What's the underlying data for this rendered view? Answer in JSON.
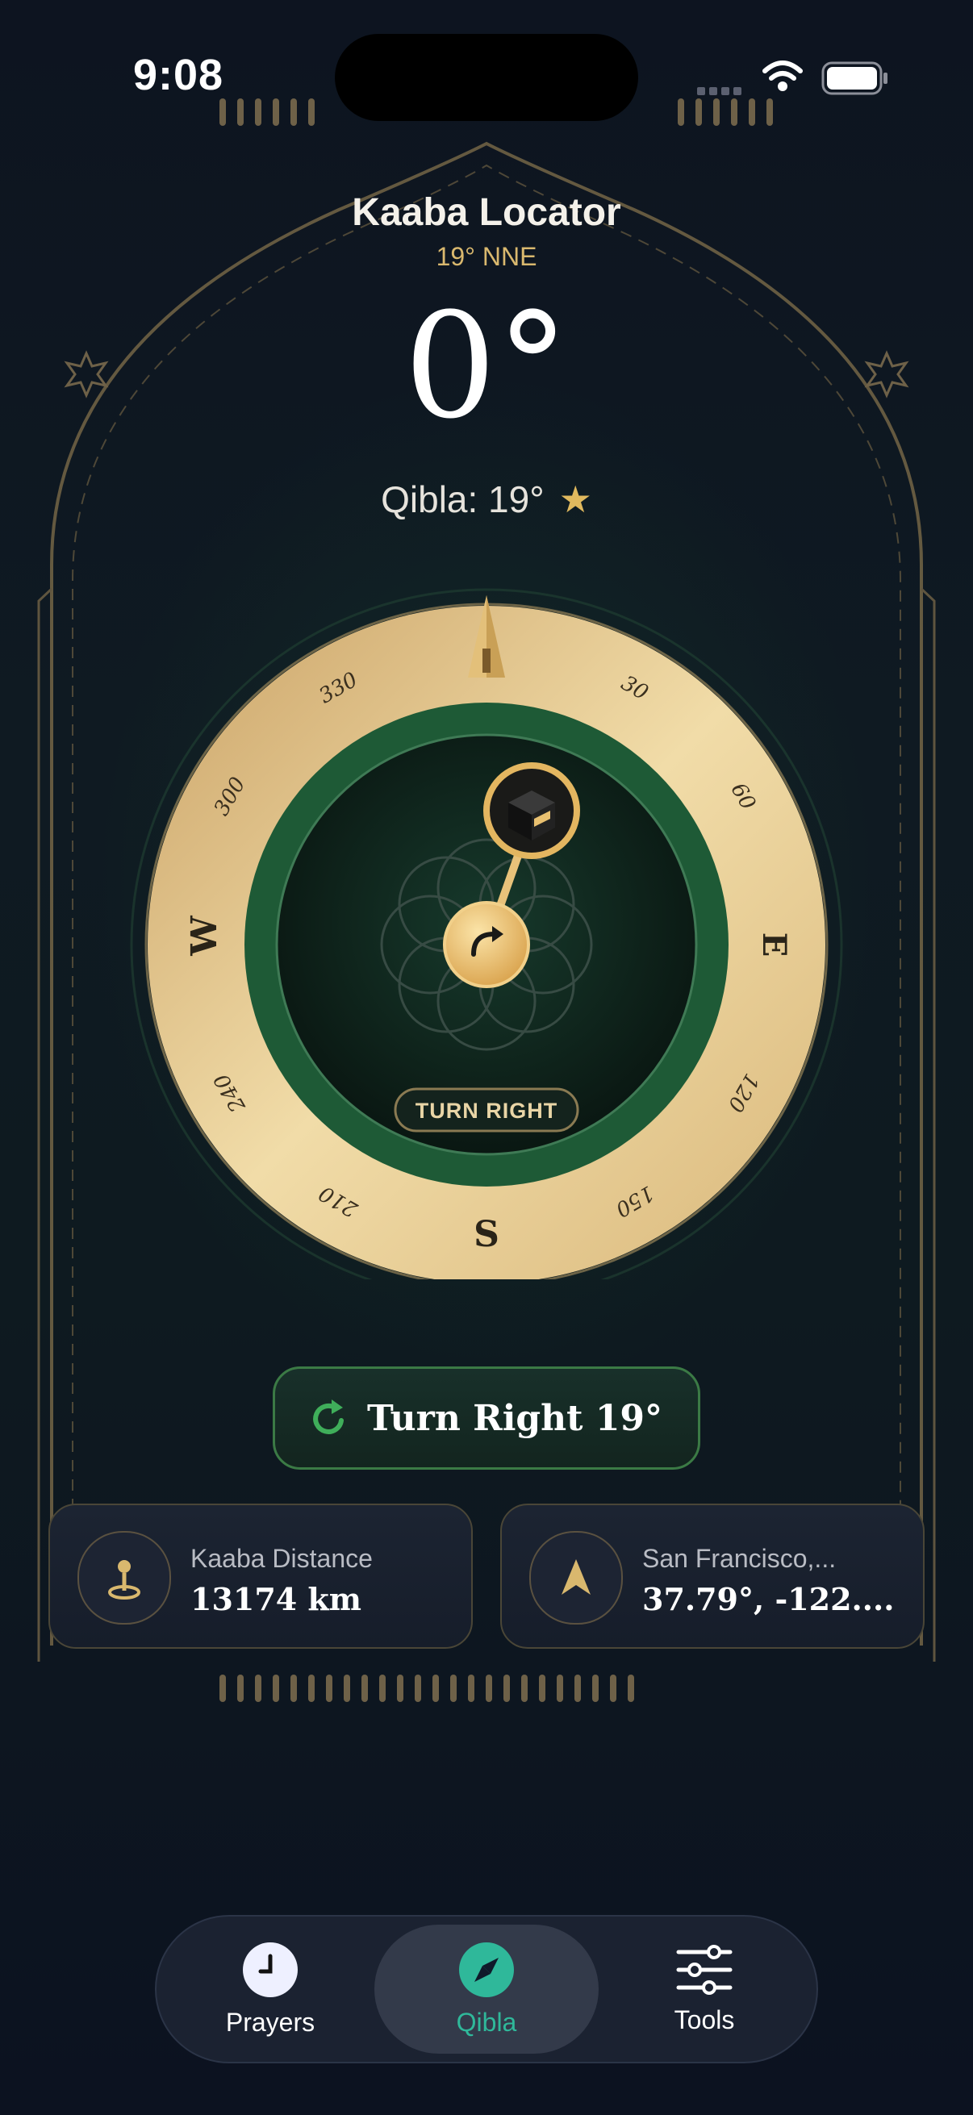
{
  "status_bar": {
    "time": "9:08"
  },
  "header": {
    "title": "Kaaba Locator",
    "subtitle": "19° NNE"
  },
  "heading_display": {
    "value": "0°"
  },
  "qibla_line": {
    "text": "Qibla: 19°",
    "star_icon": "star-icon"
  },
  "compass": {
    "cardinals": {
      "west": "W",
      "east": "E",
      "south": "S"
    },
    "degree_labels": [
      "30",
      "60",
      "120",
      "150",
      "210",
      "240",
      "300",
      "330"
    ],
    "instruction_pill": "TURN RIGHT",
    "center_icon": "turn-right-arrow-icon",
    "qibla_marker_icon": "kaaba-icon"
  },
  "turn_button": {
    "label": "Turn Right 19°",
    "icon": "refresh-icon"
  },
  "cards": {
    "distance": {
      "label": "Kaaba Distance",
      "value": "13174 km",
      "icon": "map-pin-icon"
    },
    "location": {
      "label": "San Francisco,...",
      "value": "37.79°, -122....",
      "icon": "navigation-arrow-icon"
    }
  },
  "tab_bar": {
    "tabs": [
      {
        "label": "Prayers",
        "icon": "clock-icon"
      },
      {
        "label": "Qibla",
        "icon": "compass-icon",
        "active": true
      },
      {
        "label": "Tools",
        "icon": "sliders-icon"
      }
    ]
  },
  "colors": {
    "gold": "#d9b86e",
    "green_accent": "#2fb89a",
    "ring_green": "#1f5a35",
    "background": "#0c1220"
  }
}
